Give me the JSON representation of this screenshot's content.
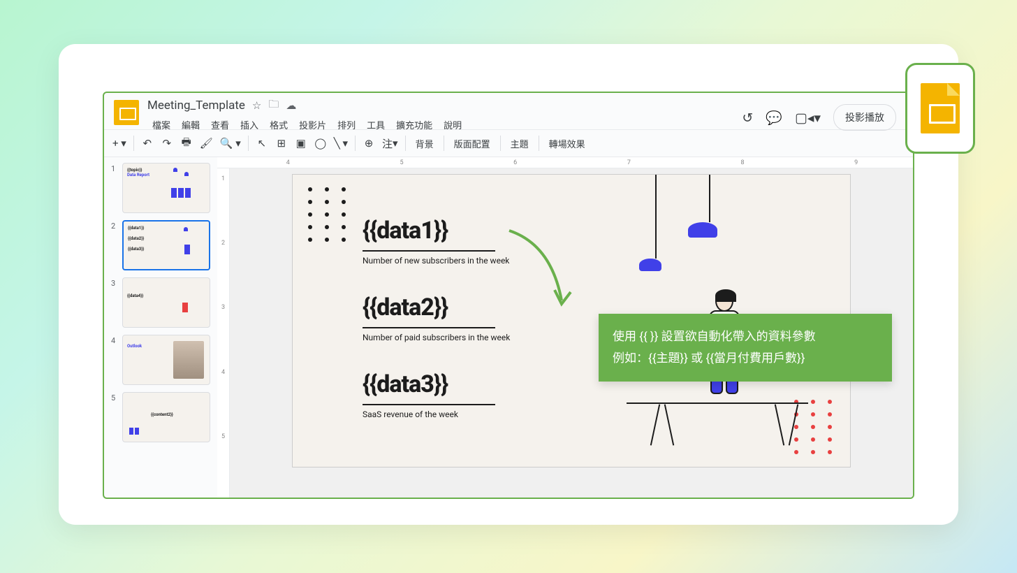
{
  "doc_title": "Meeting_Template",
  "menus": [
    "檔案",
    "編輯",
    "查看",
    "插入",
    "格式",
    "投影片",
    "排列",
    "工具",
    "擴充功能",
    "說明"
  ],
  "present_label": "投影播放",
  "toolbar_note": "注",
  "toolbar_labels": {
    "bg": "背景",
    "layout": "版面配置",
    "theme": "主題",
    "transition": "轉場效果"
  },
  "ruler_h": [
    "4",
    "5",
    "6",
    "7",
    "8",
    "9"
  ],
  "ruler_v": [
    "1",
    "2",
    "3",
    "4",
    "5"
  ],
  "thumbs": [
    {
      "n": "1",
      "line1": "{{topic}}",
      "line2": "Data Report"
    },
    {
      "n": "2",
      "line1": "{{data1}}",
      "line2": "{{data2}}",
      "line3": "{{data3}}"
    },
    {
      "n": "3",
      "line1": "{{data4}}"
    },
    {
      "n": "4",
      "line1": "Outlook"
    },
    {
      "n": "5",
      "line1": "{{content2}}"
    }
  ],
  "slide": {
    "d1": "{{data1}}",
    "s1": "Number of new subscribers in the week",
    "d2": "{{data2}}",
    "s2": "Number of paid subscribers in the week",
    "d3": "{{data3}}",
    "s3": "SaaS revenue of the week"
  },
  "callout": {
    "l1": "使用 {{ }} 設置欲自動化帶入的資料參數",
    "l2": "例如：{{主題}} 或 {{當月付費用戶數}}"
  }
}
